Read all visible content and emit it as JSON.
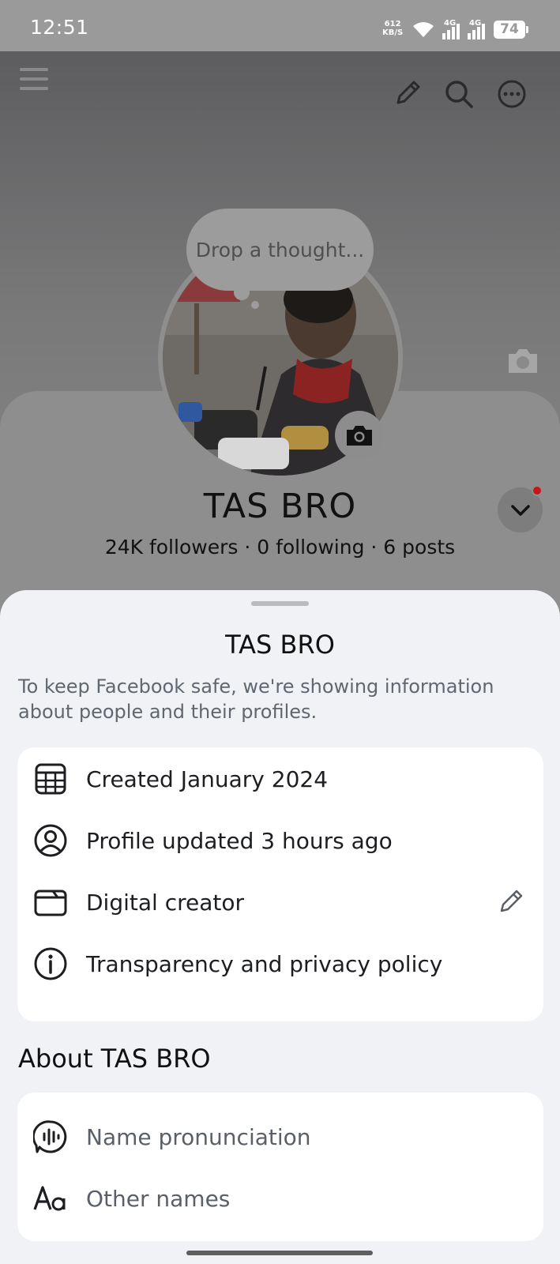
{
  "status_bar": {
    "time": "12:51",
    "net_speed_value": "612",
    "net_speed_unit": "KB/S",
    "network1": "4G",
    "network2": "4G",
    "battery": "74"
  },
  "profile": {
    "thought_placeholder": "Drop a thought...",
    "name": "TAS BRO",
    "stats": "24K followers · 0 following · 6 posts"
  },
  "sheet": {
    "title": "TAS BRO",
    "description": "To keep Facebook safe, we're showing information about people and their profiles.",
    "info_items": [
      {
        "label": "Created January 2024",
        "icon": "calendar-icon"
      },
      {
        "label": "Profile updated 3 hours ago",
        "icon": "profile-circle-icon"
      },
      {
        "label": "Digital creator",
        "icon": "category-folder-icon"
      },
      {
        "label": "Transparency and privacy policy",
        "icon": "info-icon"
      }
    ],
    "about_title": "About TAS BRO",
    "about_items": [
      {
        "label": "Name pronunciation",
        "icon": "pronunciation-icon"
      },
      {
        "label": "Other names",
        "icon": "text-aa-icon"
      }
    ]
  },
  "colors": {
    "sheet_background": "#f0f2f5",
    "card_background": "#ffffff",
    "notification_dot": "#c4171b",
    "overlay": "#8e8e8e"
  }
}
